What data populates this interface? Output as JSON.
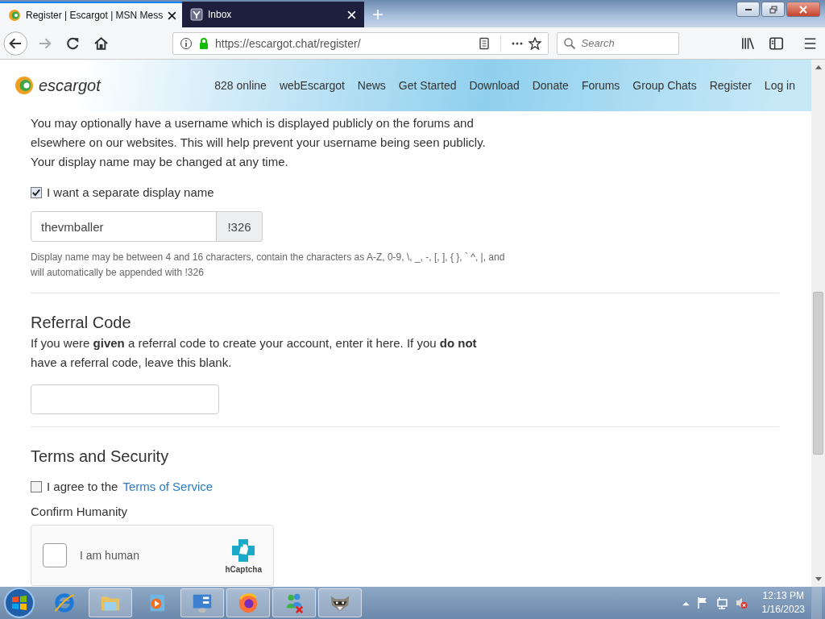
{
  "browser": {
    "tabs": [
      {
        "title": "Register | Escargot | MSN Mess",
        "selected": true,
        "kind": "escargot"
      },
      {
        "title": "Inbox",
        "selected": false,
        "kind": "mail"
      }
    ],
    "url": "https://escargot.chat/register/",
    "search": {
      "placeholder": "Search"
    }
  },
  "site": {
    "logo": "escargot",
    "nav": [
      "828 online",
      "webEscargot",
      "News",
      "Get Started",
      "Download",
      "Donate",
      "Forums",
      "Group Chats",
      "Register",
      "Log in"
    ]
  },
  "form": {
    "intro": "You may optionally have a username which is displayed publicly on the forums and elsewhere on our websites. This will help prevent your username being seen publicly. Your display name may be changed at any time.",
    "display_name_toggle": {
      "label": "I want a separate display name",
      "checked": true
    },
    "display_name": {
      "value": "thevmballer",
      "suffix": "!326"
    },
    "display_name_help": "Display name may be between 4 and 16 characters, contain the characters as A-Z, 0-9, \\, _, -, [, ], { }, ` ^, |, and will automatically be appended with !326",
    "referral": {
      "heading": "Referral Code",
      "text": "If you were **given** a referral code to create your account, enter it here. If you **do not** have a referral code, leave this blank."
    },
    "terms": {
      "heading": "Terms and Security",
      "checked": false,
      "label": "I agree to the",
      "link": "Terms of Service"
    },
    "captcha": {
      "heading": "Confirm Humanity",
      "label": "I am human",
      "checked": false,
      "brand": "hCaptcha"
    }
  },
  "taskbar": {
    "apps": [
      {
        "kind": "ie",
        "running": false
      },
      {
        "kind": "folder",
        "running": true
      },
      {
        "kind": "media",
        "running": false
      },
      {
        "kind": "panel",
        "running": true
      },
      {
        "kind": "firefox",
        "running": true
      },
      {
        "kind": "messenger",
        "running": true
      },
      {
        "kind": "raccoon",
        "running": true
      }
    ],
    "time": "12:13 PM",
    "date": "1/16/2023"
  }
}
